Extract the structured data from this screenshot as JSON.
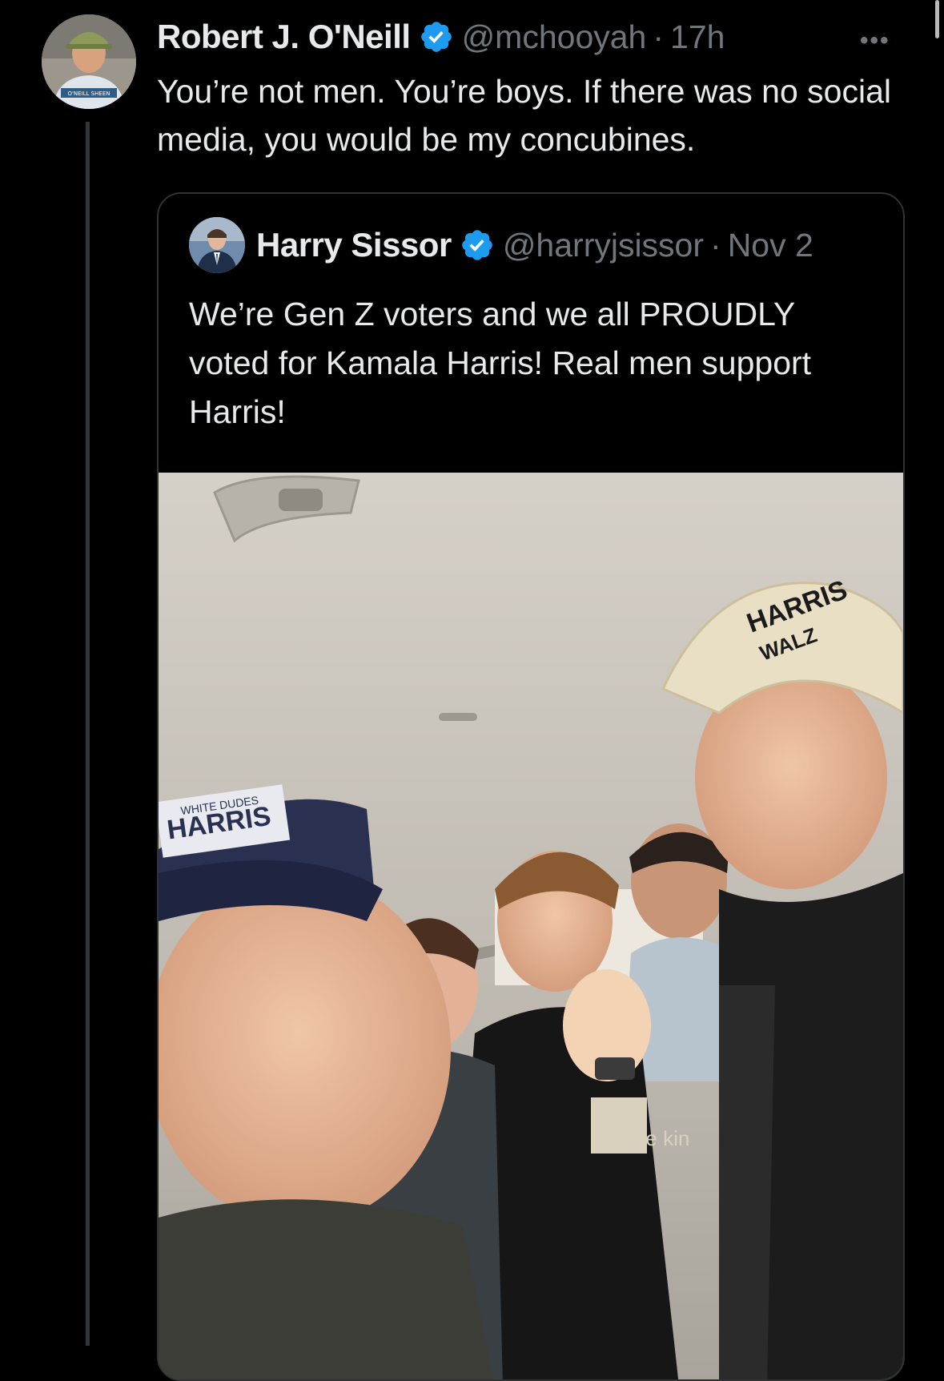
{
  "tweet": {
    "author_name": "Robert J. O'Neill",
    "handle": "@mchooyah",
    "separator": "·",
    "time": "17h",
    "more_label": "•••",
    "text": "You’re not men. You’re boys. If there was no social media, you would be my concubines.",
    "avatar_shirt_text": "O'NEILL SHEEN"
  },
  "quoted_tweet": {
    "author_name": "Harry Sissor",
    "handle": "@harryjsissor",
    "separator": "·",
    "date": "Nov 2",
    "text": "We’re Gen Z voters and we all PROUDLY voted for Kamala Harris! Real men support Harris!",
    "photo": {
      "cap_right_text_1": "HARRIS",
      "cap_right_text_2": "WALZ",
      "cap_left_text_1": "WHITE DUDES",
      "cap_left_text_2": "HARRIS",
      "shirt_text": "gone kin"
    }
  },
  "colors": {
    "background": "#000000",
    "text_primary": "#e7e9ea",
    "text_secondary": "#71767b",
    "verified_blue": "#1d9bf0",
    "border": "#2f3336"
  },
  "icons": {
    "verified": "verified-badge-icon",
    "more": "more-horizontal-icon"
  }
}
